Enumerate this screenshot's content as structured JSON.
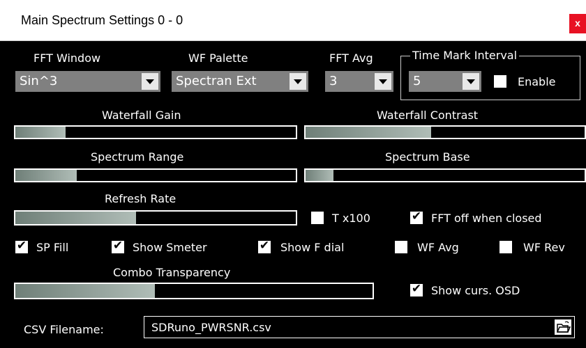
{
  "window": {
    "title": "Main Spectrum Settings 0 - 0",
    "close_label": "x"
  },
  "combos": {
    "fft_window": {
      "label": "FFT Window",
      "value": "Sin^3"
    },
    "wf_palette": {
      "label": "WF Palette",
      "value": "Spectran Ext"
    },
    "fft_avg": {
      "label": "FFT Avg",
      "value": "3"
    },
    "time_mark": {
      "label": "Time Mark Interval",
      "value": "5"
    }
  },
  "checkboxes": {
    "enable": {
      "label": "Enable",
      "checked": false
    },
    "t_x100": {
      "label": "T x100",
      "checked": false
    },
    "fft_off": {
      "label": "FFT off when closed",
      "checked": true
    },
    "sp_fill": {
      "label": "SP Fill",
      "checked": true
    },
    "show_smeter": {
      "label": "Show Smeter",
      "checked": true
    },
    "show_fdial": {
      "label": "Show F dial",
      "checked": true
    },
    "wf_avg": {
      "label": "WF Avg",
      "checked": false
    },
    "wf_rev": {
      "label": "WF Rev",
      "checked": false
    },
    "show_osd": {
      "label": "Show curs. OSD",
      "checked": true
    }
  },
  "sliders": {
    "waterfall_gain": {
      "label": "Waterfall Gain",
      "level": 0.18
    },
    "waterfall_contrast": {
      "label": "Waterfall Contrast",
      "level": 0.45
    },
    "spectrum_range": {
      "label": "Spectrum Range",
      "level": 0.22
    },
    "spectrum_base": {
      "label": "Spectrum Base",
      "level": 0.1
    },
    "refresh_rate": {
      "label": "Refresh Rate",
      "level": 0.43
    },
    "combo_transparency": {
      "label": "Combo Transparency",
      "level": 0.39
    }
  },
  "csv": {
    "label": "CSV Filename:",
    "value": "SDRuno_PWRSNR.csv",
    "browse_icon": "folder-open-icon"
  },
  "colors": {
    "background": "#000000",
    "slider_fill": "#8a9892",
    "close": "#e81123"
  }
}
